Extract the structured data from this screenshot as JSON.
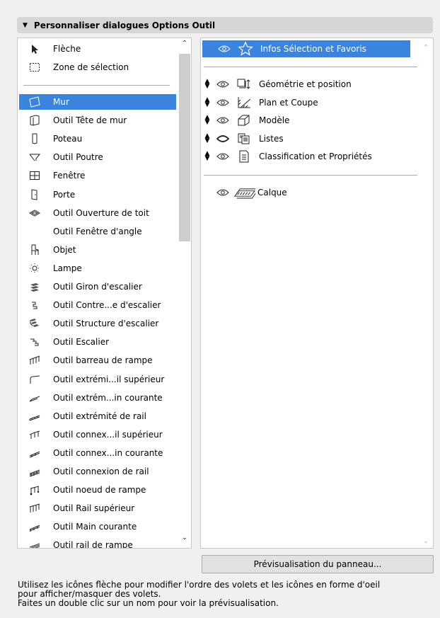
{
  "header": {
    "title": "Personnaliser dialogues Options Outil"
  },
  "left_list": {
    "top_items": [
      {
        "label": "Flèche",
        "icon": "arrow-pointer-icon"
      },
      {
        "label": "Zone de sélection",
        "icon": "marquee-icon"
      }
    ],
    "tools": [
      {
        "label": "Mur",
        "icon": "wall-icon",
        "selected": true
      },
      {
        "label": "Outil Tête de mur",
        "icon": "wall-end-icon"
      },
      {
        "label": "Poteau",
        "icon": "column-icon"
      },
      {
        "label": "Outil Poutre",
        "icon": "beam-icon"
      },
      {
        "label": "Fenêtre",
        "icon": "window-icon"
      },
      {
        "label": "Porte",
        "icon": "door-icon"
      },
      {
        "label": "Outil Ouverture de toit",
        "icon": "roof-opening-icon"
      },
      {
        "label": "Outil Fenêtre d'angle",
        "icon": ""
      },
      {
        "label": "Objet",
        "icon": "object-chair-icon"
      },
      {
        "label": "Lampe",
        "icon": "lamp-icon"
      },
      {
        "label": "Outil Giron d'escalier",
        "icon": "stair-tread-icon"
      },
      {
        "label": "Outil Contre...e d'escalier",
        "icon": "stair-riser-icon"
      },
      {
        "label": "Outil Structure d'escalier",
        "icon": "stair-structure-icon"
      },
      {
        "label": "Outil Escalier",
        "icon": "stair-icon"
      },
      {
        "label": "Outil barreau de rampe",
        "icon": "railing-baluster-icon"
      },
      {
        "label": "Outil extrémi...il supérieur",
        "icon": "railing-end-icon"
      },
      {
        "label": "Outil extrém...in courante",
        "icon": "handrail-end-icon"
      },
      {
        "label": "Outil extrémité de rail",
        "icon": "rail-end-icon"
      },
      {
        "label": "Outil connex...il supérieur",
        "icon": "toprail-connection-icon"
      },
      {
        "label": "Outil connex...in courante",
        "icon": "handrail-connection-icon"
      },
      {
        "label": "Outil connexion de rail",
        "icon": "rail-connection-icon"
      },
      {
        "label": "Outil noeud de rampe",
        "icon": "railing-node-icon"
      },
      {
        "label": "Outil Rail supérieur",
        "icon": "top-rail-icon"
      },
      {
        "label": "Outil Main courante",
        "icon": "handrail-icon"
      },
      {
        "label": "Outil rail de rampe",
        "icon": "rail-icon"
      }
    ]
  },
  "panels": {
    "top": {
      "label": "Infos Sélection et Favoris",
      "icon": "star-icon",
      "selected": true
    },
    "middle": [
      {
        "label": "Géométrie et position",
        "icon": "geometry-icon",
        "eye": "open"
      },
      {
        "label": "Plan et Coupe",
        "icon": "floorplan-section-icon",
        "eye": "open"
      },
      {
        "label": "Modèle",
        "icon": "model-icon",
        "eye": "open"
      },
      {
        "label": "Listes",
        "icon": "listing-icon",
        "eye": "closed"
      },
      {
        "label": "Classification et Propriétés",
        "icon": "classification-icon",
        "eye": "open"
      }
    ],
    "bottom": {
      "label": "Calque",
      "icon": "layers-icon"
    }
  },
  "preview_button": "Prévisualisation du panneau...",
  "help_text": [
    "Utilisez les icônes flèche pour modifier l'ordre des volets et les icônes en forme d'oeil",
    "pour afficher/masquer des volets.",
    "Faites un double clic sur un nom pour voir la prévisualisation."
  ],
  "colors": {
    "selection": "#3b84dd",
    "header_bg": "#d6d6d6"
  }
}
